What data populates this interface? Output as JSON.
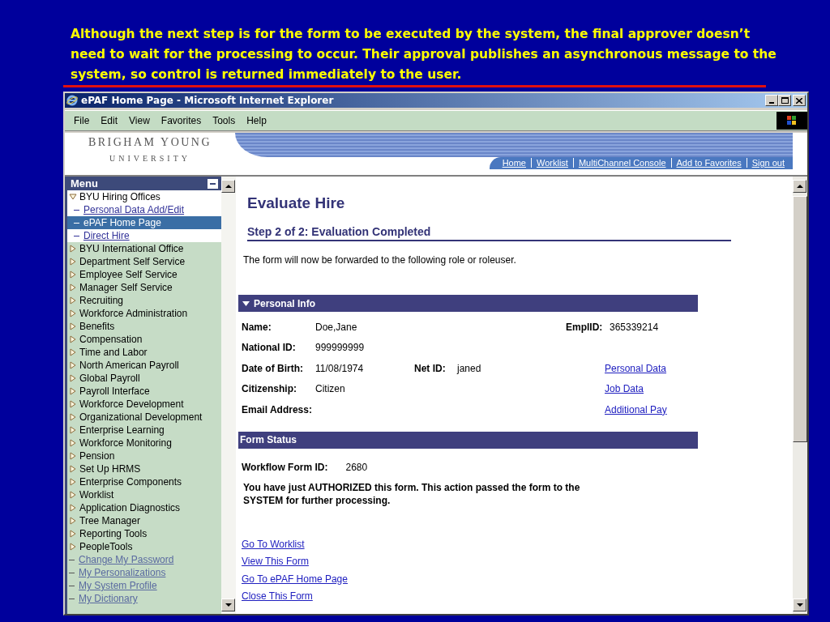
{
  "caption": "Although the next step is for the form to be executed by the system, the final approver doesn’t need to wait for the processing to occur. Their approval publishes an asynchronous message to the system, so control is returned immediately to the user.",
  "window": {
    "title": "ePAF Home Page - Microsoft Internet Explorer"
  },
  "menubar": [
    "File",
    "Edit",
    "View",
    "Favorites",
    "Tools",
    "Help"
  ],
  "header": {
    "logo_line1": "BRIGHAM YOUNG",
    "logo_line2": "UNIVERSITY",
    "nav": [
      "Home",
      "Worklist",
      "MultiChannel Console",
      "Add to Favorites",
      "Sign out"
    ]
  },
  "sidebar": {
    "title": "Menu",
    "items": [
      {
        "label": "BYU Hiring Offices",
        "kind": "folder",
        "expanded": true,
        "selected": false,
        "children": [
          {
            "label": "Personal Data Add/Edit",
            "kind": "link",
            "selected": false
          },
          {
            "label": "ePAF Home Page",
            "kind": "link",
            "selected": true
          },
          {
            "label": "Direct Hire",
            "kind": "link",
            "selected": false
          }
        ]
      },
      {
        "label": "BYU International Office",
        "kind": "folder",
        "expanded": false,
        "selected": false
      },
      {
        "label": "Department Self Service",
        "kind": "folder",
        "expanded": false,
        "selected": false
      },
      {
        "label": "Employee Self Service",
        "kind": "folder",
        "expanded": false,
        "selected": false
      },
      {
        "label": "Manager Self Service",
        "kind": "folder",
        "expanded": false,
        "selected": false
      },
      {
        "label": "Recruiting",
        "kind": "folder",
        "expanded": false,
        "selected": false
      },
      {
        "label": "Workforce Administration",
        "kind": "folder",
        "expanded": false,
        "selected": false
      },
      {
        "label": "Benefits",
        "kind": "folder",
        "expanded": false,
        "selected": false
      },
      {
        "label": "Compensation",
        "kind": "folder",
        "expanded": false,
        "selected": false
      },
      {
        "label": "Time and Labor",
        "kind": "folder",
        "expanded": false,
        "selected": false
      },
      {
        "label": "North American Payroll",
        "kind": "folder",
        "expanded": false,
        "selected": false
      },
      {
        "label": "Global Payroll",
        "kind": "folder",
        "expanded": false,
        "selected": false
      },
      {
        "label": "Payroll Interface",
        "kind": "folder",
        "expanded": false,
        "selected": false
      },
      {
        "label": "Workforce Development",
        "kind": "folder",
        "expanded": false,
        "selected": false
      },
      {
        "label": "Organizational Development",
        "kind": "folder",
        "expanded": false,
        "selected": false
      },
      {
        "label": "Enterprise Learning",
        "kind": "folder",
        "expanded": false,
        "selected": false
      },
      {
        "label": "Workforce Monitoring",
        "kind": "folder",
        "expanded": false,
        "selected": false
      },
      {
        "label": "Pension",
        "kind": "folder",
        "expanded": false,
        "selected": false
      },
      {
        "label": "Set Up HRMS",
        "kind": "folder",
        "expanded": false,
        "selected": false
      },
      {
        "label": "Enterprise Components",
        "kind": "folder",
        "expanded": false,
        "selected": false
      },
      {
        "label": "Worklist",
        "kind": "folder",
        "expanded": false,
        "selected": false
      },
      {
        "label": "Application Diagnostics",
        "kind": "folder",
        "expanded": false,
        "selected": false
      },
      {
        "label": "Tree Manager",
        "kind": "folder",
        "expanded": false,
        "selected": false
      },
      {
        "label": "Reporting Tools",
        "kind": "folder",
        "expanded": false,
        "selected": false
      },
      {
        "label": "PeopleTools",
        "kind": "folder",
        "expanded": false,
        "selected": false
      },
      {
        "label": "Change My Password",
        "kind": "link",
        "selected": false
      },
      {
        "label": "My Personalizations",
        "kind": "link",
        "selected": false
      },
      {
        "label": "My System Profile",
        "kind": "link",
        "selected": false
      },
      {
        "label": "My Dictionary",
        "kind": "link",
        "selected": false
      }
    ]
  },
  "main": {
    "title": "Evaluate Hire",
    "step": "Step 2 of 2: Evaluation Completed",
    "intro": "The form will now be forwarded to the following role or roleuser.",
    "personal_info": {
      "title": "Personal Info",
      "expanded": true,
      "rows": [
        {
          "label": "Name:",
          "value": "Doe,Jane",
          "side_label": "EmplID:",
          "side_value": "365339214"
        },
        {
          "label": "National ID:",
          "value": "999999999"
        },
        {
          "label": "Date of Birth:",
          "value": "11/08/1974",
          "mid_label": "Net ID:",
          "mid_value": "janed",
          "link": "Personal Data"
        },
        {
          "label": "Citizenship:",
          "value": "Citizen",
          "link": "Job Data"
        },
        {
          "label": "Email Address:",
          "link": "Additional Pay"
        }
      ]
    },
    "form_status": {
      "title": "Form Status",
      "id_label": "Workflow Form ID:",
      "id_value": "2680",
      "message": "You have just AUTHORIZED this form. This action passed the form to the SYSTEM for further processing."
    },
    "actions": [
      "Go To Worklist",
      "View This Form",
      "Go To ePAF Home Page",
      "Close This Form"
    ]
  }
}
